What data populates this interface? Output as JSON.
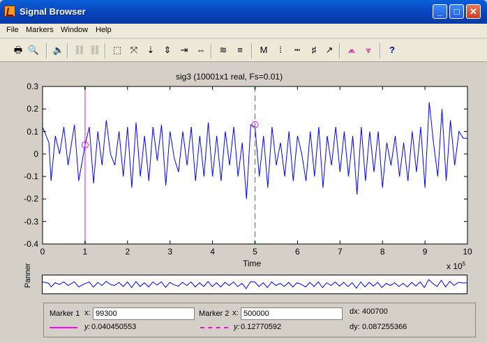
{
  "window": {
    "title": "Signal Browser",
    "minimize": "_",
    "maximize": "□",
    "close": "✕"
  },
  "menu": [
    "File",
    "Markers",
    "Window",
    "Help"
  ],
  "toolbar": {
    "icons": [
      "print-icon",
      "print-preview-icon",
      "play-sound-icon",
      "link-icon",
      "unlink-icon",
      "zoom-box-icon",
      "zoom-all-icon",
      "zoom-y-out-icon",
      "zoom-y-in-icon",
      "zoom-x-out-icon",
      "zoom-x-in-icon",
      "array-signals-icon",
      "line-props-icon",
      "markers-toggle-icon",
      "vertical-markers-icon",
      "horizontal-markers-icon",
      "track-markers-icon",
      "slope-markers-icon",
      "peaks-icon",
      "valleys-icon",
      "whats-this-icon"
    ],
    "glyphs": [
      "🖶",
      "🔍",
      "🔈",
      "⛓",
      "⛓",
      "⬚",
      "⤧",
      "⇣",
      "⇕",
      "⇥",
      "⇔",
      "≋",
      "≡",
      "M",
      "⁞",
      "┅",
      "♯",
      "↗",
      "⩕",
      "⩔",
      "?"
    ]
  },
  "plot": {
    "title": "sig3 (10001x1 real, Fs=0.01)",
    "xlabel": "Time",
    "x_exponent": "x 10",
    "x_exponent_power": "5",
    "panner_label": "Panner"
  },
  "chart_data": {
    "type": "line",
    "title": "sig3 (10001x1 real, Fs=0.01)",
    "xlabel": "Time",
    "ylabel": "",
    "xlim": [
      0,
      10
    ],
    "ylim": [
      -0.4,
      0.3
    ],
    "xticks": [
      "0",
      "1",
      "2",
      "3",
      "4",
      "5",
      "6",
      "7",
      "8",
      "9",
      "10"
    ],
    "yticks": [
      "0.3",
      "0.2",
      "0.1",
      "0",
      "-0.1",
      "-0.2",
      "-0.3",
      "-0.4"
    ],
    "x_multiplier": "x 10^5",
    "series": [
      {
        "color": "#0000ff",
        "x": [
          0,
          0.15,
          0.2,
          0.3,
          0.4,
          0.5,
          0.6,
          0.75,
          0.85,
          1.0,
          1.1,
          1.2,
          1.3,
          1.4,
          1.5,
          1.6,
          1.7,
          1.8,
          1.9,
          2.0,
          2.1,
          2.2,
          2.3,
          2.4,
          2.5,
          2.6,
          2.7,
          2.8,
          2.9,
          3.0,
          3.1,
          3.2,
          3.3,
          3.4,
          3.5,
          3.6,
          3.7,
          3.8,
          3.9,
          4.0,
          4.1,
          4.2,
          4.3,
          4.4,
          4.5,
          4.6,
          4.7,
          4.8,
          4.9,
          5.0,
          5.1,
          5.2,
          5.3,
          5.4,
          5.5,
          5.6,
          5.7,
          5.8,
          5.9,
          6.0,
          6.1,
          6.2,
          6.3,
          6.4,
          6.5,
          6.6,
          6.7,
          6.8,
          6.9,
          7.0,
          7.1,
          7.2,
          7.3,
          7.4,
          7.5,
          7.6,
          7.7,
          7.8,
          7.9,
          8.0,
          8.1,
          8.2,
          8.3,
          8.4,
          8.5,
          8.6,
          8.7,
          8.8,
          8.9,
          9.0,
          9.1,
          9.2,
          9.3,
          9.4,
          9.5,
          9.6,
          9.7,
          9.8,
          9.9,
          10.0
        ],
        "y": [
          0.12,
          0.05,
          -0.12,
          0.08,
          0.0,
          0.12,
          -0.05,
          0.13,
          -0.12,
          0.04,
          0.12,
          -0.13,
          0.1,
          -0.05,
          0.15,
          0.0,
          -0.05,
          0.1,
          -0.1,
          0.12,
          -0.15,
          0.14,
          -0.1,
          0.08,
          -0.12,
          0.12,
          -0.03,
          0.13,
          -0.14,
          0.1,
          -0.02,
          -0.08,
          0.1,
          -0.05,
          0.12,
          -0.12,
          0.08,
          -0.1,
          0.14,
          -0.1,
          0.08,
          -0.12,
          0.1,
          -0.05,
          0.12,
          -0.1,
          0.05,
          -0.2,
          0.13,
          0.12,
          -0.1,
          0.08,
          -0.15,
          0.12,
          -0.05,
          0.05,
          -0.1,
          0.1,
          -0.12,
          0.08,
          0.0,
          -0.12,
          0.1,
          -0.1,
          0.12,
          -0.15,
          0.08,
          -0.05,
          0.12,
          -0.08,
          0.1,
          -0.1,
          0.08,
          -0.18,
          0.12,
          -0.12,
          0.1,
          -0.08,
          0.1,
          -0.15,
          0.05,
          -0.05,
          0.08,
          -0.1,
          0.05,
          -0.12,
          0.1,
          -0.08,
          0.12,
          -0.15,
          0.23,
          0.05,
          -0.1,
          0.2,
          -0.12,
          0.15,
          -0.05,
          0.1,
          0.07,
          0.07
        ]
      }
    ],
    "markers": [
      {
        "x": 1.0,
        "y": 0.04,
        "color": "#ff00ff",
        "style": "solid"
      },
      {
        "x": 5.0,
        "y": 0.13,
        "color": "#ff00ff",
        "style": "dashed"
      }
    ]
  },
  "marker_panel": {
    "marker1_label": "Marker 1",
    "marker1_x_label": "x:",
    "marker1_x": "99300",
    "marker1_y_label": "y:",
    "marker1_y": "0.040450553",
    "marker2_label": "Marker 2",
    "marker2_x_label": "x:",
    "marker2_x": "500000",
    "marker2_y_label": "y:",
    "marker2_y": "0.12770592",
    "dx_label": "dx:",
    "dx": "400700",
    "dy_label": "dy:",
    "dy": "0.087255366",
    "marker_color": "#ff00ff"
  }
}
